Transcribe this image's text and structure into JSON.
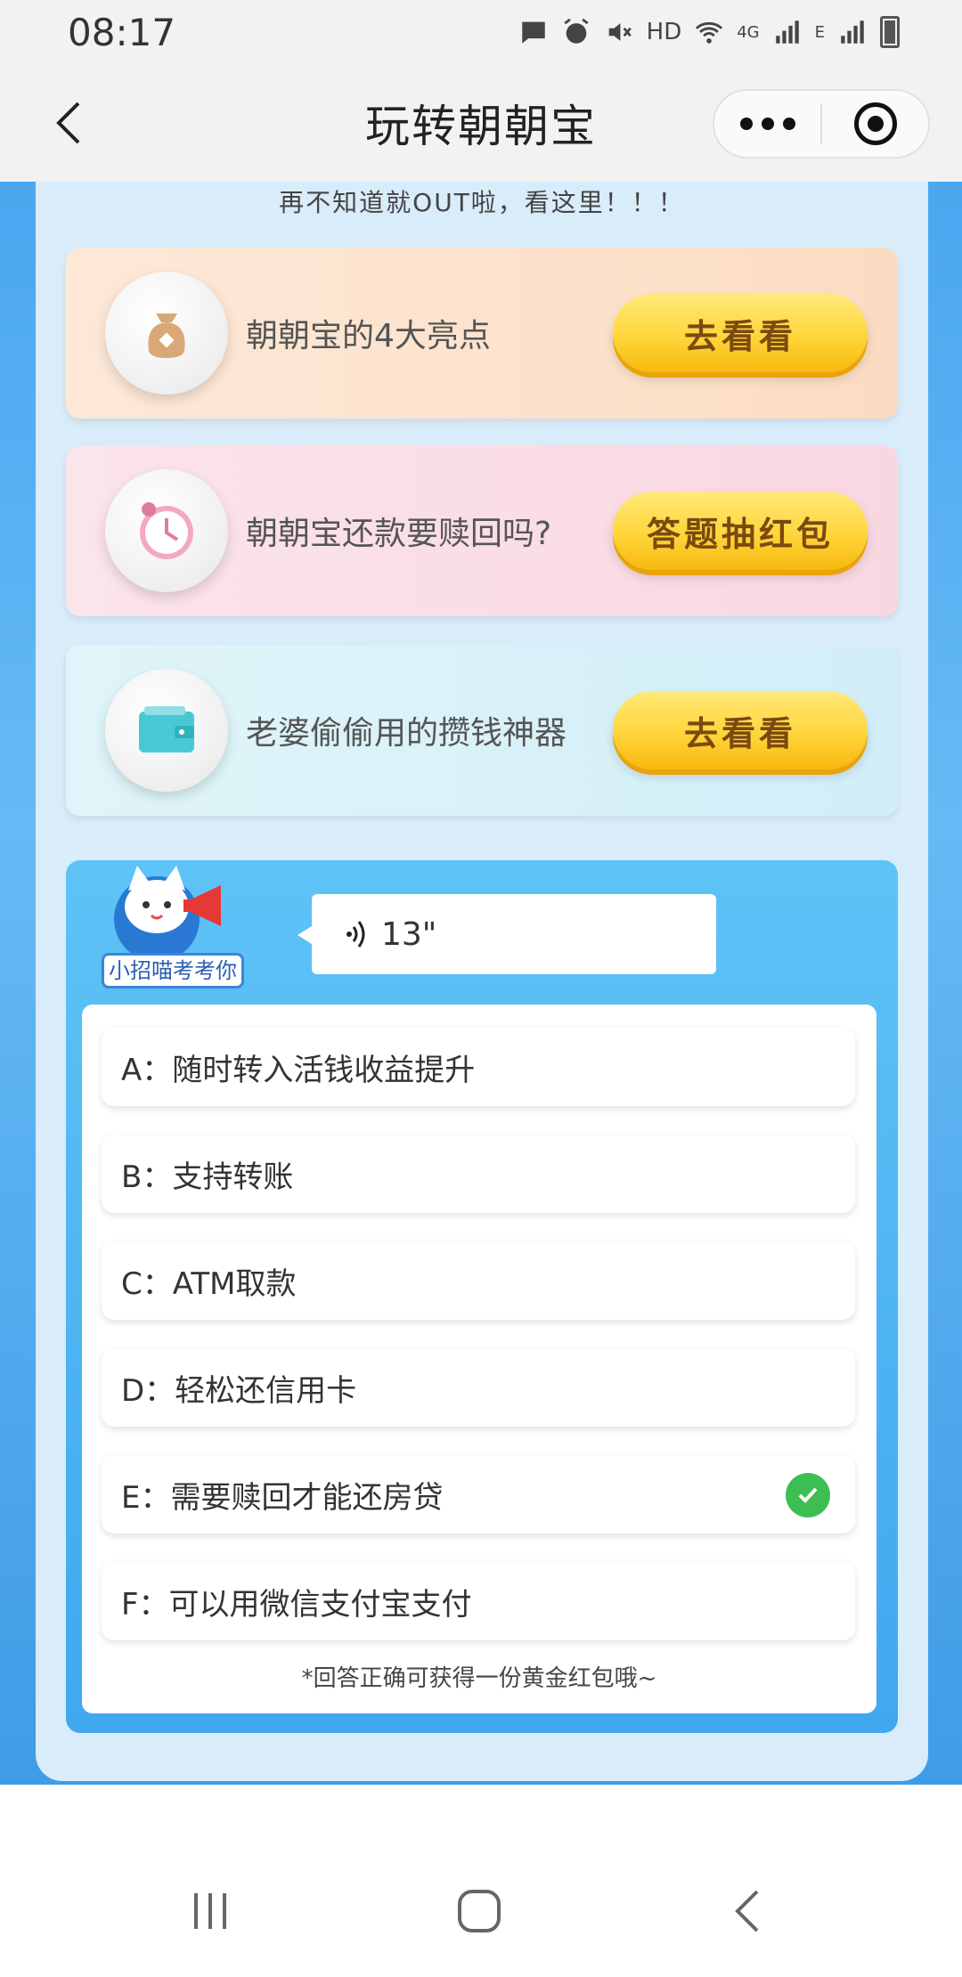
{
  "status_bar": {
    "time": "08:17",
    "network_label": "HD",
    "signal_label_1": "4G",
    "signal_label_2": "E"
  },
  "nav": {
    "title": "玩转朝朝宝"
  },
  "intro": "再不知道就OUT啦，看这里！！！",
  "cards": [
    {
      "label": "朝朝宝的4大亮点",
      "button": "去看看",
      "icon": "money-bag-icon"
    },
    {
      "label": "朝朝宝还款要赎回吗?",
      "button": "答题抽红包",
      "icon": "clock-icon"
    },
    {
      "label": "老婆偷偷用的攒钱神器",
      "button": "去看看",
      "icon": "wallet-icon"
    }
  ],
  "quiz": {
    "mascot_tag": "小招喵考考你",
    "audio_duration": "13\"",
    "options": [
      {
        "text": "A：随时转入活钱收益提升",
        "selected": false
      },
      {
        "text": "B：支持转账",
        "selected": false
      },
      {
        "text": "C：ATM取款",
        "selected": false
      },
      {
        "text": "D：轻松还信用卡",
        "selected": false
      },
      {
        "text": "E：需要赎回才能还房贷",
        "selected": true
      },
      {
        "text": "F：可以用微信支付宝支付",
        "selected": false
      }
    ],
    "footnote": "*回答正确可获得一份黄金红包哦~"
  },
  "colors": {
    "accent_blue": "#3fa8ef",
    "button_gold": "#ffd53a",
    "check_green": "#3dbe53"
  }
}
